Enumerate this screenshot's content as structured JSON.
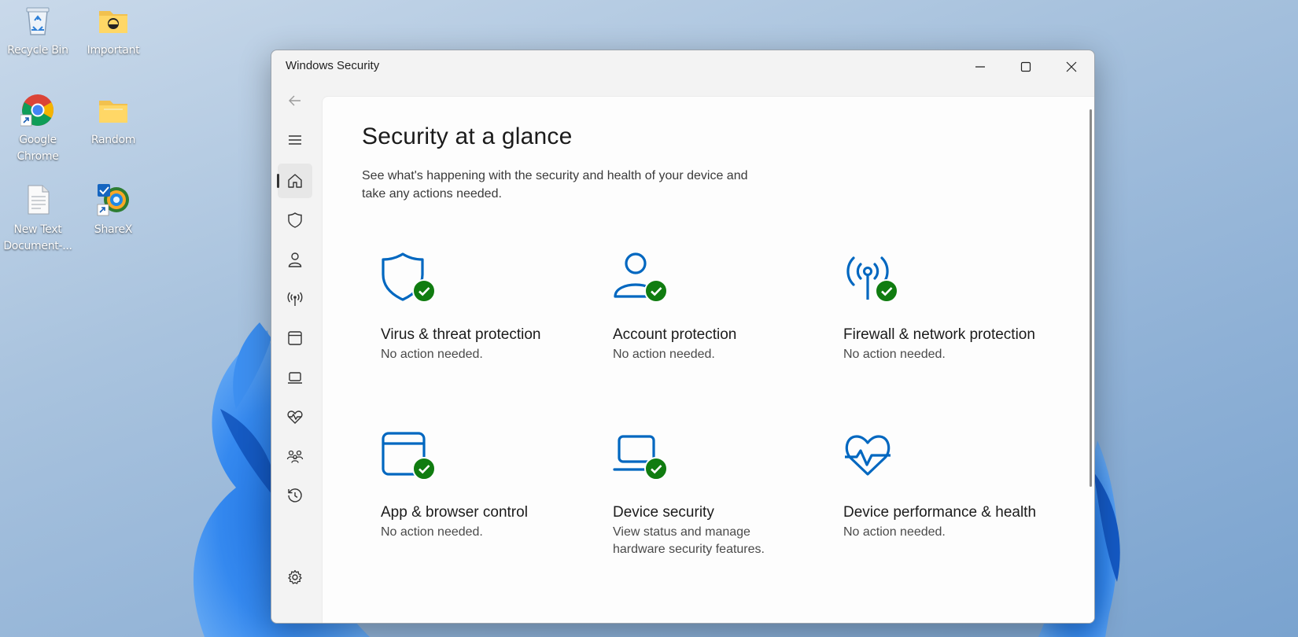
{
  "desktop": {
    "icons": [
      {
        "label": "Recycle Bin",
        "icon": "recycle-bin-icon"
      },
      {
        "label": "Important",
        "icon": "folder-icon"
      },
      {
        "label": "Google Chrome",
        "icon": "chrome-icon"
      },
      {
        "label": "Random",
        "icon": "folder-icon"
      },
      {
        "label": "New Text Document-...",
        "icon": "text-document-icon"
      },
      {
        "label": "ShareX",
        "icon": "sharex-icon"
      }
    ]
  },
  "window": {
    "title": "Windows Security",
    "controls": {
      "minimize": "minimize-icon",
      "maximize": "maximize-icon",
      "close": "close-icon"
    }
  },
  "nav": {
    "items": [
      {
        "name": "back",
        "icon": "back-arrow-icon"
      },
      {
        "name": "menu",
        "icon": "hamburger-menu-icon"
      },
      {
        "name": "home",
        "icon": "home-icon",
        "selected": true
      },
      {
        "name": "virus-threat",
        "icon": "shield-icon"
      },
      {
        "name": "account",
        "icon": "person-icon"
      },
      {
        "name": "firewall",
        "icon": "antenna-icon"
      },
      {
        "name": "app-browser",
        "icon": "app-window-icon"
      },
      {
        "name": "device-security",
        "icon": "laptop-icon"
      },
      {
        "name": "device-performance",
        "icon": "heart-pulse-icon"
      },
      {
        "name": "family",
        "icon": "family-icon"
      },
      {
        "name": "history",
        "icon": "history-icon"
      },
      {
        "name": "settings",
        "icon": "gear-icon"
      }
    ]
  },
  "main": {
    "title": "Security at a glance",
    "subtitle": "See what's happening with the security and health of your device and take any actions needed.",
    "tiles": [
      {
        "title": "Virus & threat protection",
        "status": "No action needed.",
        "icon": "shield-icon",
        "ok": true
      },
      {
        "title": "Account protection",
        "status": "No action needed.",
        "icon": "person-icon",
        "ok": true
      },
      {
        "title": "Firewall & network protection",
        "status": "No action needed.",
        "icon": "antenna-icon",
        "ok": true
      },
      {
        "title": "App & browser control",
        "status": "No action needed.",
        "icon": "app-window-icon",
        "ok": true
      },
      {
        "title": "Device security",
        "status": "View status and manage hardware security features.",
        "icon": "laptop-icon",
        "ok": true
      },
      {
        "title": "Device performance & health",
        "status": "No action needed.",
        "icon": "heart-pulse-icon",
        "ok": false
      }
    ]
  },
  "colors": {
    "accent": "#0067c0",
    "ok_green": "#107c10"
  }
}
